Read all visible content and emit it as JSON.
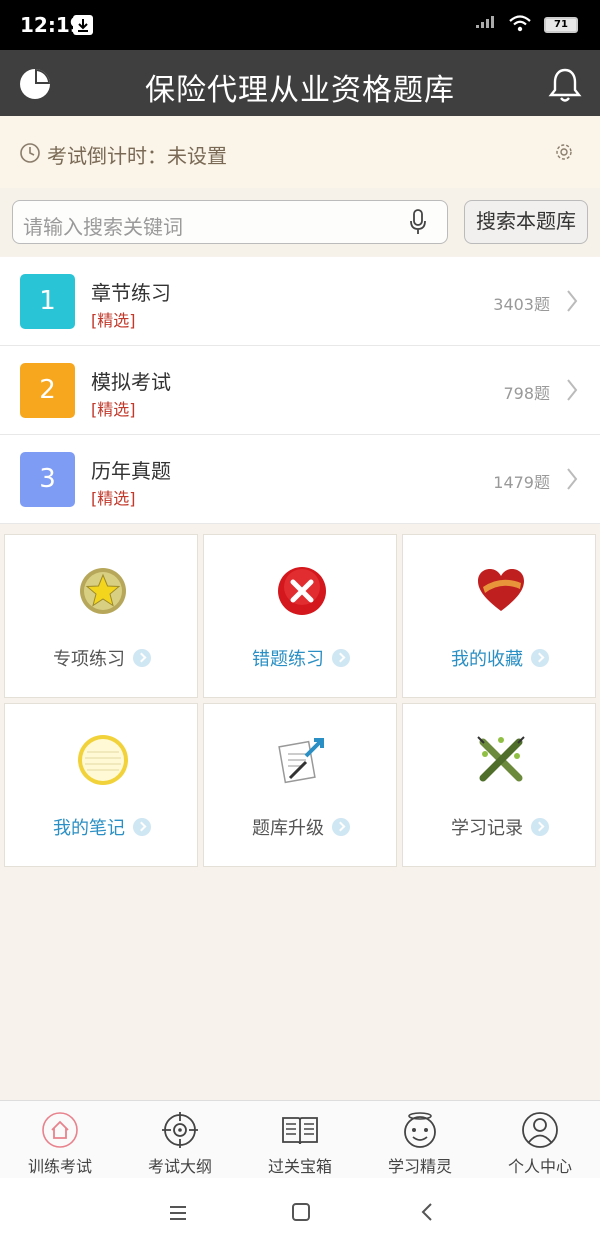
{
  "status": {
    "time": "12:19",
    "battery": "71"
  },
  "header": {
    "title": "保险代理从业资格题库"
  },
  "countdown": {
    "text": "考试倒计时：未设置"
  },
  "search": {
    "placeholder": "请输入搜索关键词",
    "button_label": "搜索本题库"
  },
  "list": [
    {
      "number": "1",
      "title": "章节练习",
      "tag": "[精选]",
      "count": "3403题",
      "color": "#29c4d6"
    },
    {
      "number": "2",
      "title": "模拟考试",
      "tag": "[精选]",
      "count": "798题",
      "color": "#f7a71d"
    },
    {
      "number": "3",
      "title": "历年真题",
      "tag": "[精选]",
      "count": "1479题",
      "color": "#7f9cf5"
    }
  ],
  "tiles": [
    {
      "label": "专项练习",
      "icon": "star-medal-icon",
      "color": "#555555"
    },
    {
      "label": "错题练习",
      "icon": "red-x-icon",
      "color": "#2a8fc4"
    },
    {
      "label": "我的收藏",
      "icon": "heart-icon",
      "color": "#2a8fc4"
    },
    {
      "label": "我的笔记",
      "icon": "notepad-icon",
      "color": "#2a8fc4"
    },
    {
      "label": "题库升级",
      "icon": "upgrade-doc-icon",
      "color": "#555555"
    },
    {
      "label": "学习记录",
      "icon": "crossed-pencils-icon",
      "color": "#555555"
    }
  ],
  "tabs": [
    {
      "label": "训练考试",
      "icon": "home-icon",
      "active": true
    },
    {
      "label": "考试大纲",
      "icon": "target-icon"
    },
    {
      "label": "过关宝箱",
      "icon": "book-icon"
    },
    {
      "label": "学习精灵",
      "icon": "smiley-icon"
    },
    {
      "label": "个人中心",
      "icon": "user-icon"
    }
  ]
}
